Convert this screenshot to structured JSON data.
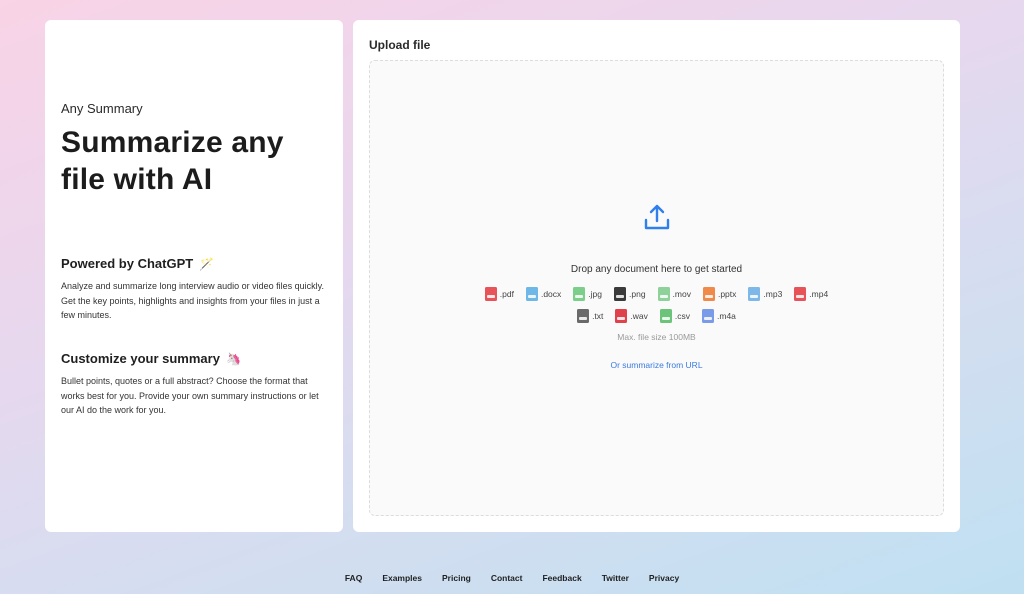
{
  "left": {
    "brand": "Any Summary",
    "hero": "Summarize any file with AI",
    "sections": [
      {
        "title": "Powered by ChatGPT",
        "emoji": "🪄",
        "body": "Analyze and summarize long interview audio or video files quickly. Get the key points, highlights and insights from your files in just a few minutes."
      },
      {
        "title": "Customize your summary",
        "emoji": "🦄",
        "body": "Bullet points, quotes or a full abstract? Choose the format that works best for you. Provide your own summary instructions or let our AI do the work for you."
      }
    ]
  },
  "upload": {
    "title": "Upload file",
    "drop_text": "Drop any document here to get started",
    "max_size": "Max. file size 100MB",
    "url_link": "Or summarize from URL",
    "file_types_row1": [
      {
        "ext": ".pdf",
        "color": "#e8535a",
        "icon": "pdf-file-icon"
      },
      {
        "ext": ".docx",
        "color": "#6fb7e6",
        "icon": "docx-file-icon"
      },
      {
        "ext": ".jpg",
        "color": "#7ccf8a",
        "icon": "jpg-file-icon"
      },
      {
        "ext": ".png",
        "color": "#3a3a3a",
        "icon": "png-file-icon"
      },
      {
        "ext": ".mov",
        "color": "#8fd19a",
        "icon": "mov-file-icon"
      },
      {
        "ext": ".pptx",
        "color": "#f08a4b",
        "icon": "pptx-file-icon"
      },
      {
        "ext": ".mp3",
        "color": "#7eb8e8",
        "icon": "mp3-file-icon"
      },
      {
        "ext": ".mp4",
        "color": "#e8535a",
        "icon": "mp4-file-icon"
      }
    ],
    "file_types_row2": [
      {
        "ext": ".txt",
        "color": "#6a6a6a",
        "icon": "txt-file-icon"
      },
      {
        "ext": ".wav",
        "color": "#e0414a",
        "icon": "wav-file-icon"
      },
      {
        "ext": ".csv",
        "color": "#6cc47a",
        "icon": "csv-file-icon"
      },
      {
        "ext": ".m4a",
        "color": "#7a9be8",
        "icon": "m4a-file-icon"
      }
    ],
    "accent": "#2f80ed"
  },
  "footer": {
    "links": [
      "FAQ",
      "Examples",
      "Pricing",
      "Contact",
      "Feedback",
      "Twitter",
      "Privacy"
    ]
  }
}
